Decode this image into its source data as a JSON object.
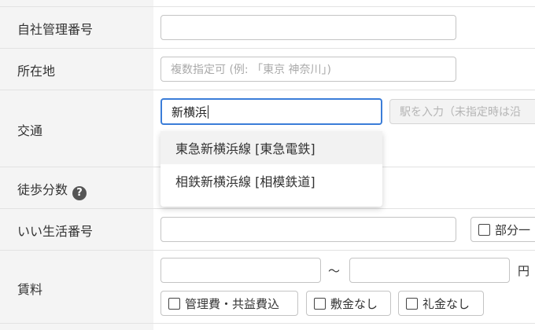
{
  "fields": {
    "company_no": {
      "label": "自社管理番号",
      "value": ""
    },
    "location": {
      "label": "所在地",
      "placeholder": "複数指定可 (例: 「東京 神奈川」)"
    },
    "transport": {
      "label": "交通",
      "line_value": "新横浜",
      "station_placeholder": "駅を入力（未指定時は沿",
      "suggestions": [
        "東急新横浜線 [東急電鉄]",
        "相鉄新横浜線 [相模鉄道]"
      ]
    },
    "walk": {
      "label": "徒歩分数",
      "help_icon": "?"
    },
    "iisei_no": {
      "label": "いい生活番号",
      "value": "",
      "partial_match": "部分一"
    },
    "rent": {
      "label": "賃料",
      "range_separator": "〜",
      "unit": "円",
      "checkboxes": [
        "管理費・共益費込",
        "敷金なし",
        "礼金なし"
      ]
    }
  },
  "colors": {
    "label_bg": "#f4f4f4",
    "focus_border": "#3b7dd8",
    "divider": "#e2e2e2"
  }
}
